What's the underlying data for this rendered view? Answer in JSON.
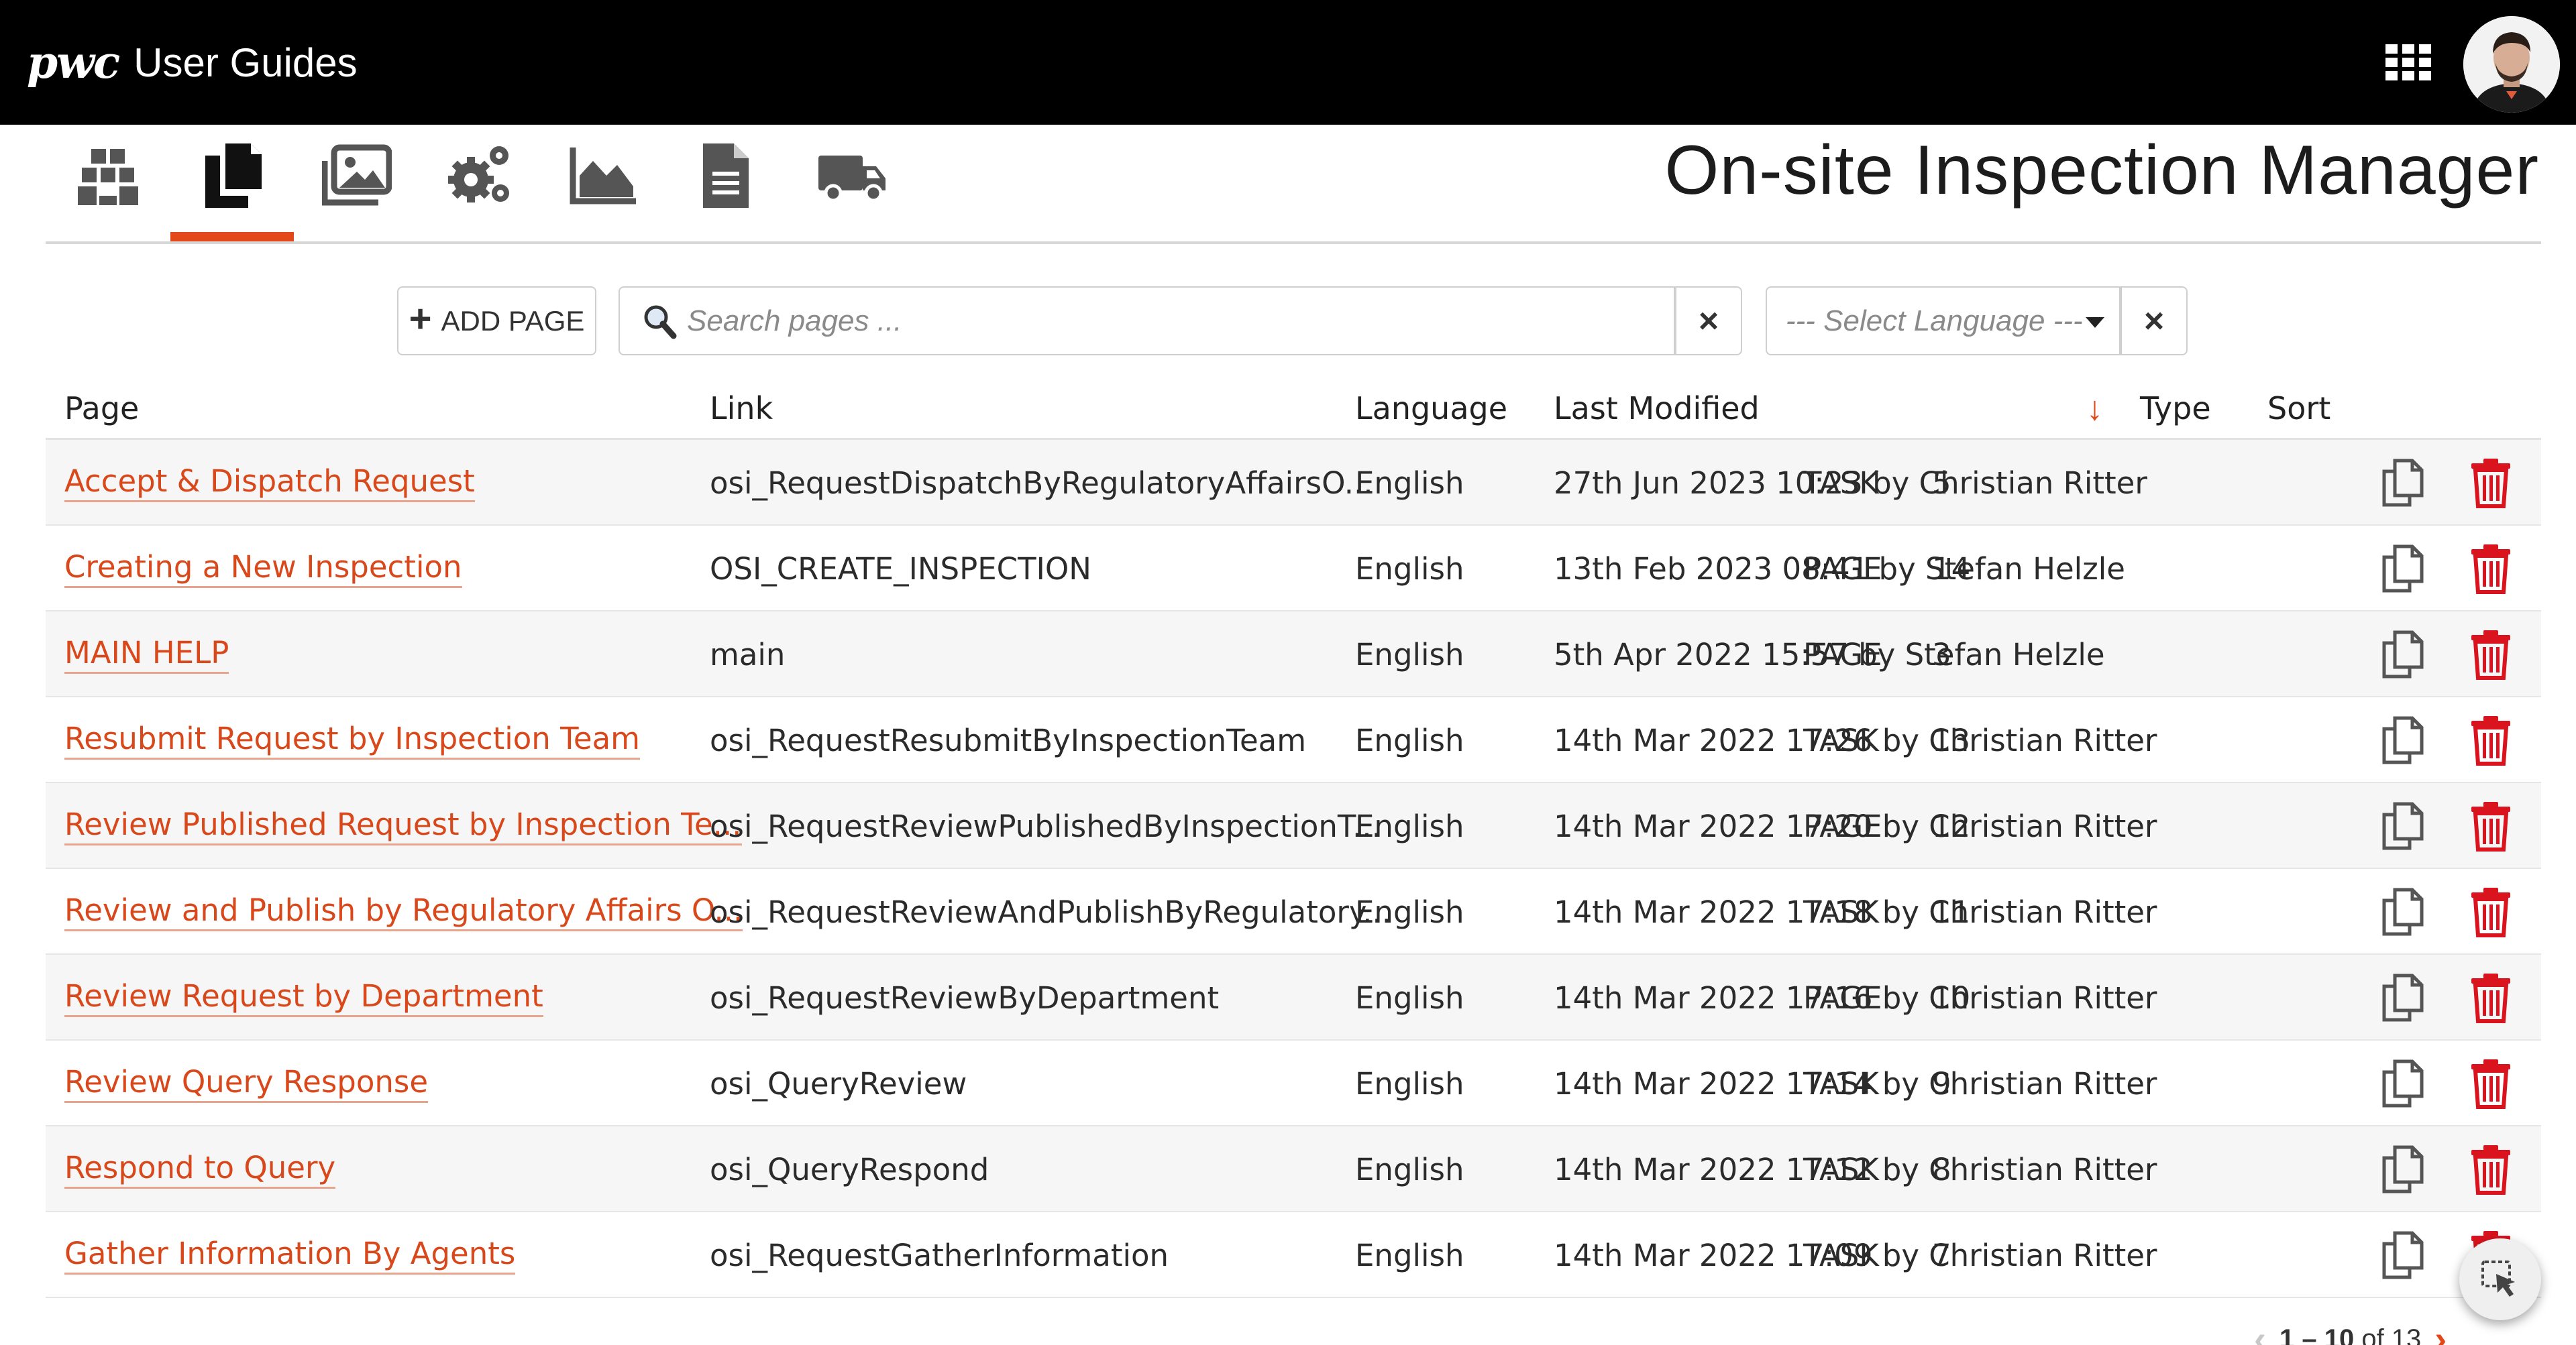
{
  "header": {
    "logo_text": "pwc",
    "app_title": "User Guides",
    "apps_icon": "apps-grid-icon",
    "avatar_icon": "user-avatar"
  },
  "toolbar": {
    "items": [
      {
        "name": "boxes-icon",
        "active": false
      },
      {
        "name": "pages-icon",
        "active": true
      },
      {
        "name": "images-icon",
        "active": false
      },
      {
        "name": "settings-icon",
        "active": false
      },
      {
        "name": "chart-icon",
        "active": false
      },
      {
        "name": "document-icon",
        "active": false
      },
      {
        "name": "truck-icon",
        "active": false
      }
    ],
    "accent_color": "#e3481b"
  },
  "page_title": "On-site Inspection Manager",
  "filters": {
    "add_page_label": "ADD PAGE",
    "search_placeholder": "Search pages ...",
    "language_placeholder": "--- Select Language ---"
  },
  "table": {
    "columns": {
      "page": "Page",
      "link": "Link",
      "language": "Language",
      "last_modified": "Last Modified",
      "type": "Type",
      "sort": "Sort"
    },
    "sorted_by": "Last Modified",
    "sort_direction": "descending",
    "rows": [
      {
        "page": "Accept & Dispatch Request",
        "link": "osi_RequestDispatchByRegulatoryAffairsO...",
        "language": "English",
        "modified": "27th Jun 2023 10:23 by Christian Ritter",
        "type": "TASK",
        "sort": "5"
      },
      {
        "page": "Creating a New Inspection",
        "link": "OSI_CREATE_INSPECTION",
        "language": "English",
        "modified": "13th Feb 2023 08:41 by Stefan Helzle",
        "type": "PAGE",
        "sort": "14"
      },
      {
        "page": "MAIN HELP",
        "link": "main",
        "language": "English",
        "modified": "5th Apr 2022 15:57 by Stefan Helzle",
        "type": "PAGE",
        "sort": "3"
      },
      {
        "page": "Resubmit Request by Inspection Team",
        "link": "osi_RequestResubmitByInspectionTeam",
        "language": "English",
        "modified": "14th Mar 2022 17:26 by Christian Ritter",
        "type": "TASK",
        "sort": "13"
      },
      {
        "page": "Review Published Request by Inspection Te...",
        "link": "osi_RequestReviewPublishedByInspectionT...",
        "language": "English",
        "modified": "14th Mar 2022 17:20 by Christian Ritter",
        "type": "PAGE",
        "sort": "12"
      },
      {
        "page": "Review and Publish by Regulatory Affairs O...",
        "link": "osi_RequestReviewAndPublishByRegulatory...",
        "language": "English",
        "modified": "14th Mar 2022 17:18 by Christian Ritter",
        "type": "TASK",
        "sort": "11"
      },
      {
        "page": "Review Request by Department",
        "link": "osi_RequestReviewByDepartment",
        "language": "English",
        "modified": "14th Mar 2022 17:16 by Christian Ritter",
        "type": "PAGE",
        "sort": "10"
      },
      {
        "page": "Review Query Response",
        "link": "osi_QueryReview",
        "language": "English",
        "modified": "14th Mar 2022 17:14 by Christian Ritter",
        "type": "TASK",
        "sort": "9"
      },
      {
        "page": "Respond to Query",
        "link": "osi_QueryRespond",
        "language": "English",
        "modified": "14th Mar 2022 17:12 by Christian Ritter",
        "type": "TASK",
        "sort": "8"
      },
      {
        "page": "Gather Information By Agents",
        "link": "osi_RequestGatherInformation",
        "language": "English",
        "modified": "14th Mar 2022 17:09 by Christian Ritter",
        "type": "TASK",
        "sort": "7"
      }
    ],
    "row_actions": {
      "copy_icon": "copy-icon",
      "delete_icon": "trash-icon",
      "delete_color": "#d9141e"
    }
  },
  "pagination": {
    "range": "1 – 10",
    "of_label": "of 13"
  }
}
